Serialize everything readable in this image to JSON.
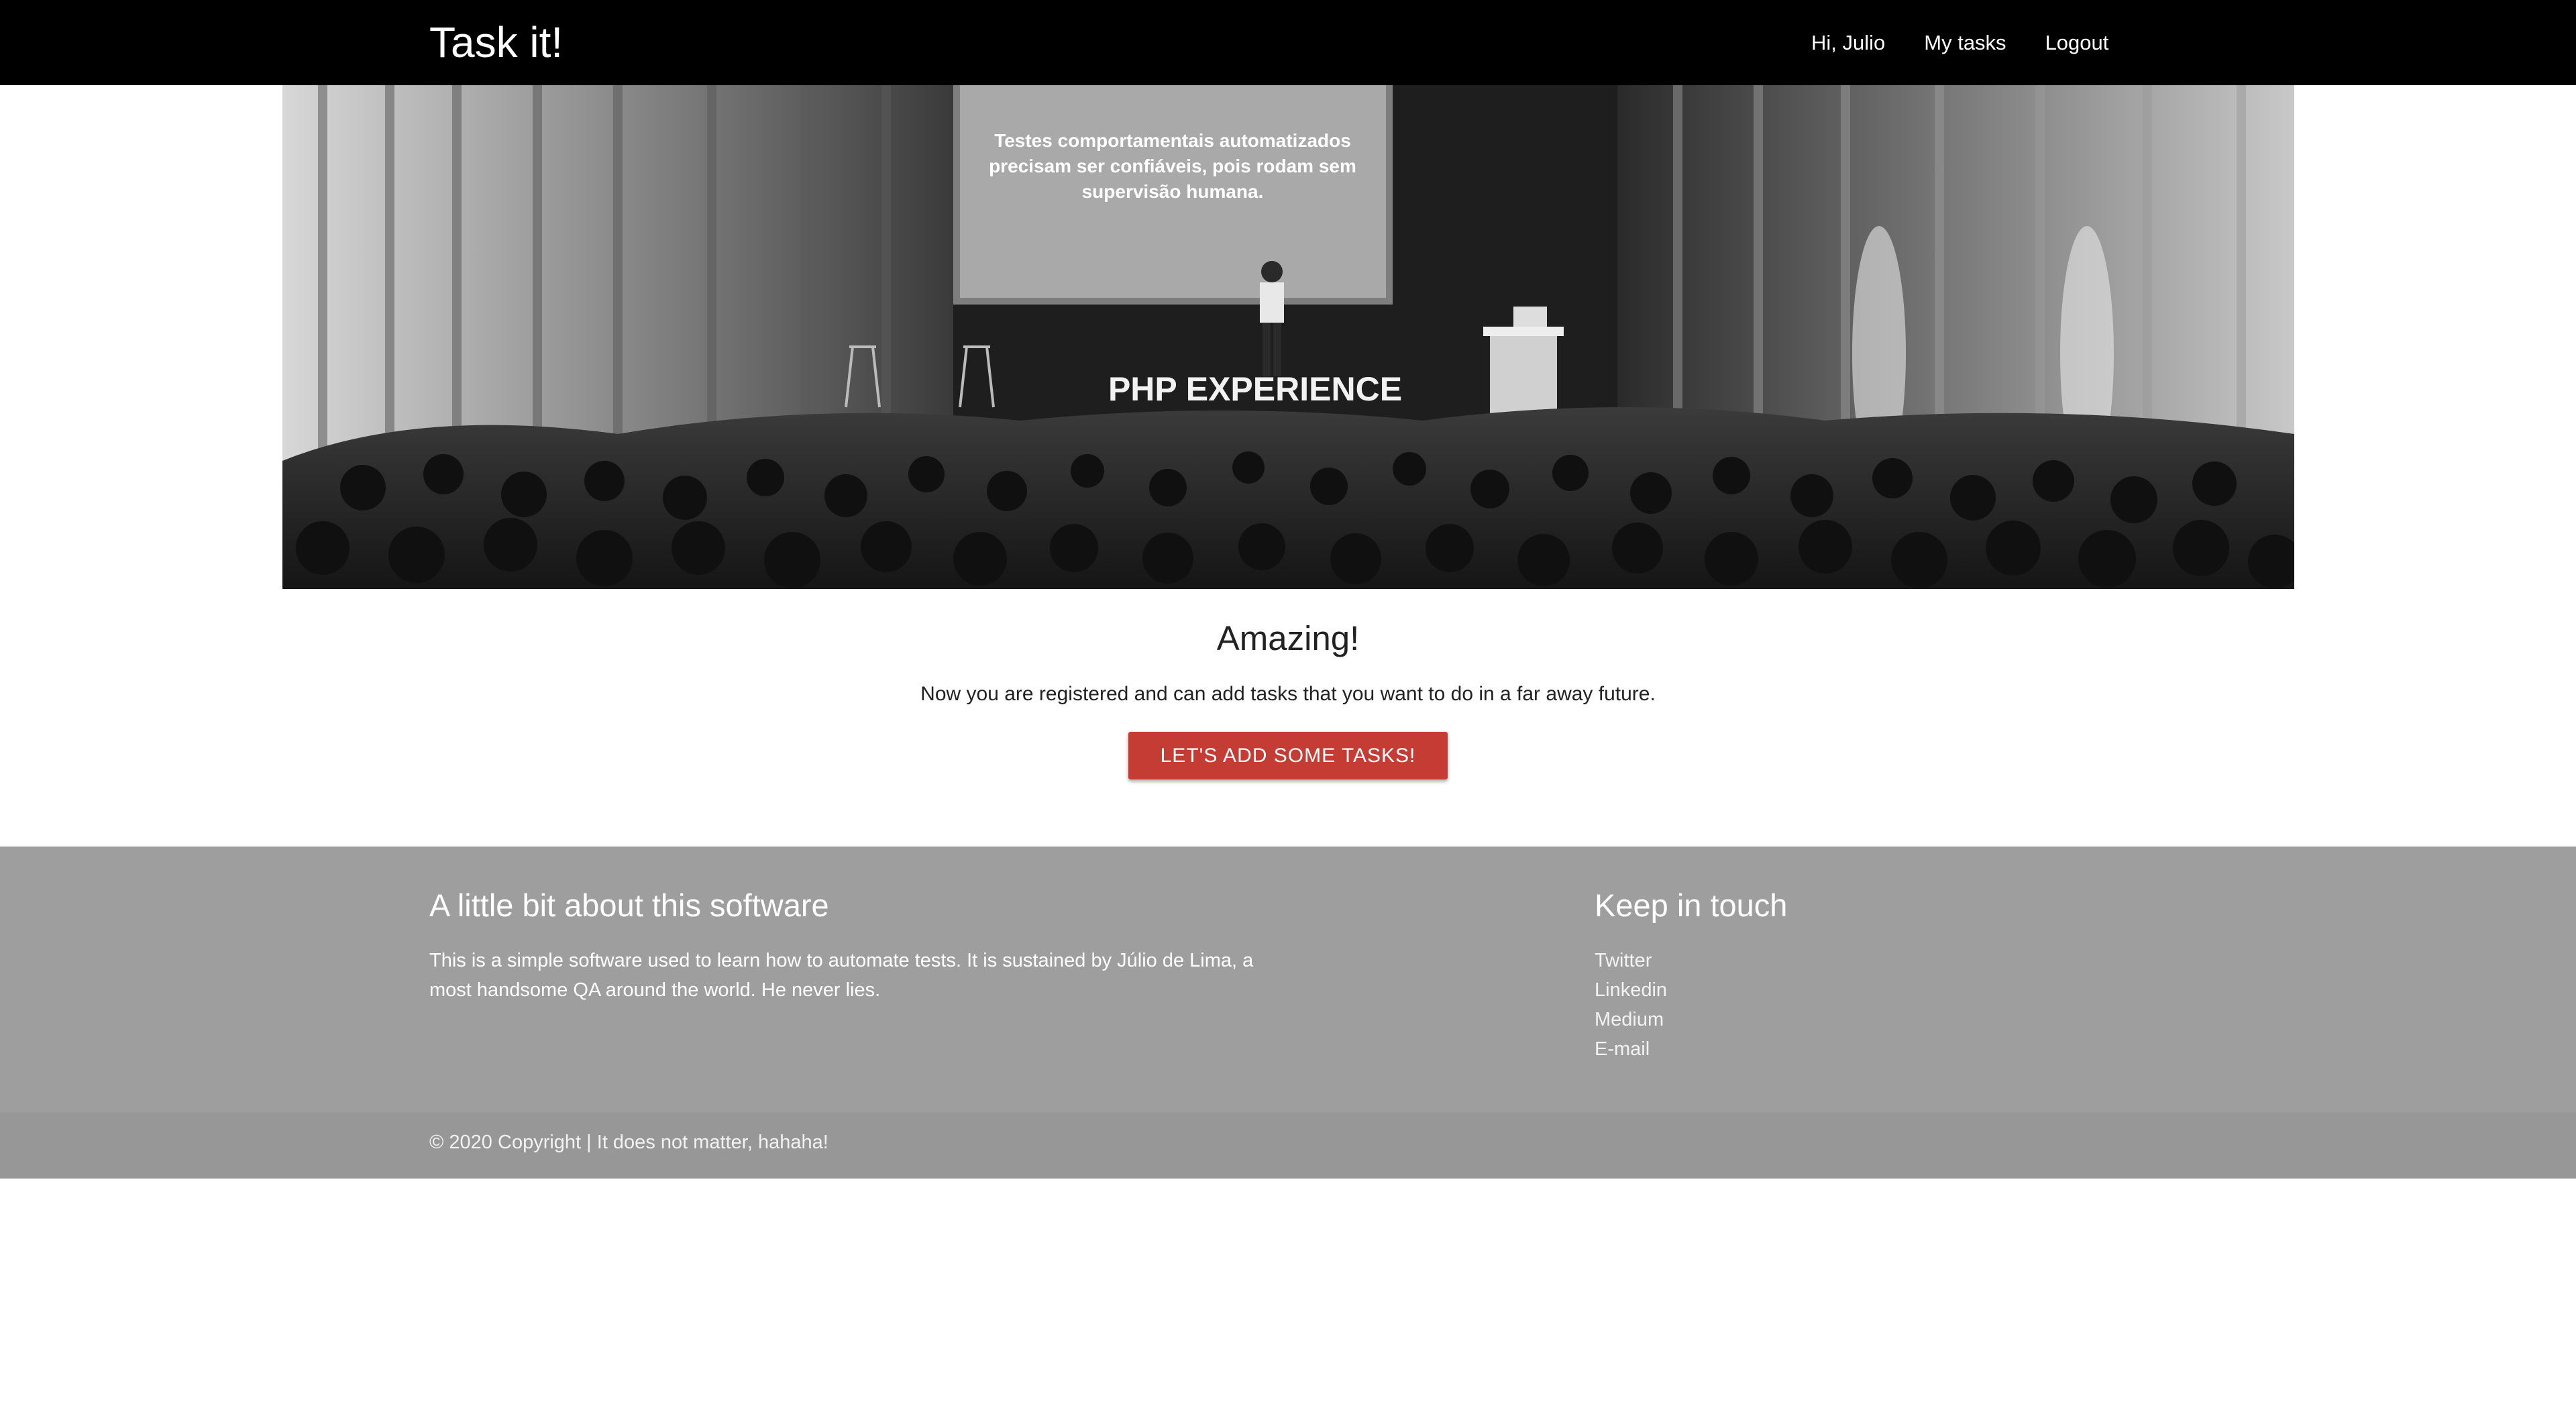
{
  "nav": {
    "brand": "Task it!",
    "links": [
      "Hi, Julio",
      "My tasks",
      "Logout"
    ]
  },
  "hero": {
    "screen_lines": [
      "Testes comportamentais automatizados",
      "precisam ser confiáveis, pois rodam sem",
      "supervisão humana."
    ],
    "stage_text": "PHP EXPERIENCE"
  },
  "main": {
    "heading": "Amazing!",
    "subtitle": "Now you are registered and can add tasks that you want to do in a far away future.",
    "cta_label": "LET'S ADD SOME TASKS!"
  },
  "footer": {
    "about_title": "A little bit about this software",
    "about_text": "This is a simple software used to learn how to automate tests. It is sustained by Júlio de Lima, a most handsome QA around the world. He never lies.",
    "contact_title": "Keep in touch",
    "contact_links": [
      "Twitter",
      "Linkedin",
      "Medium",
      "E-mail"
    ],
    "copyright": "© 2020 Copyright | It does not matter, hahaha!"
  },
  "colors": {
    "navbar": "#000000",
    "cta": "#c53c34",
    "footer": "#9e9e9e",
    "copyright_bar": "#979797"
  }
}
